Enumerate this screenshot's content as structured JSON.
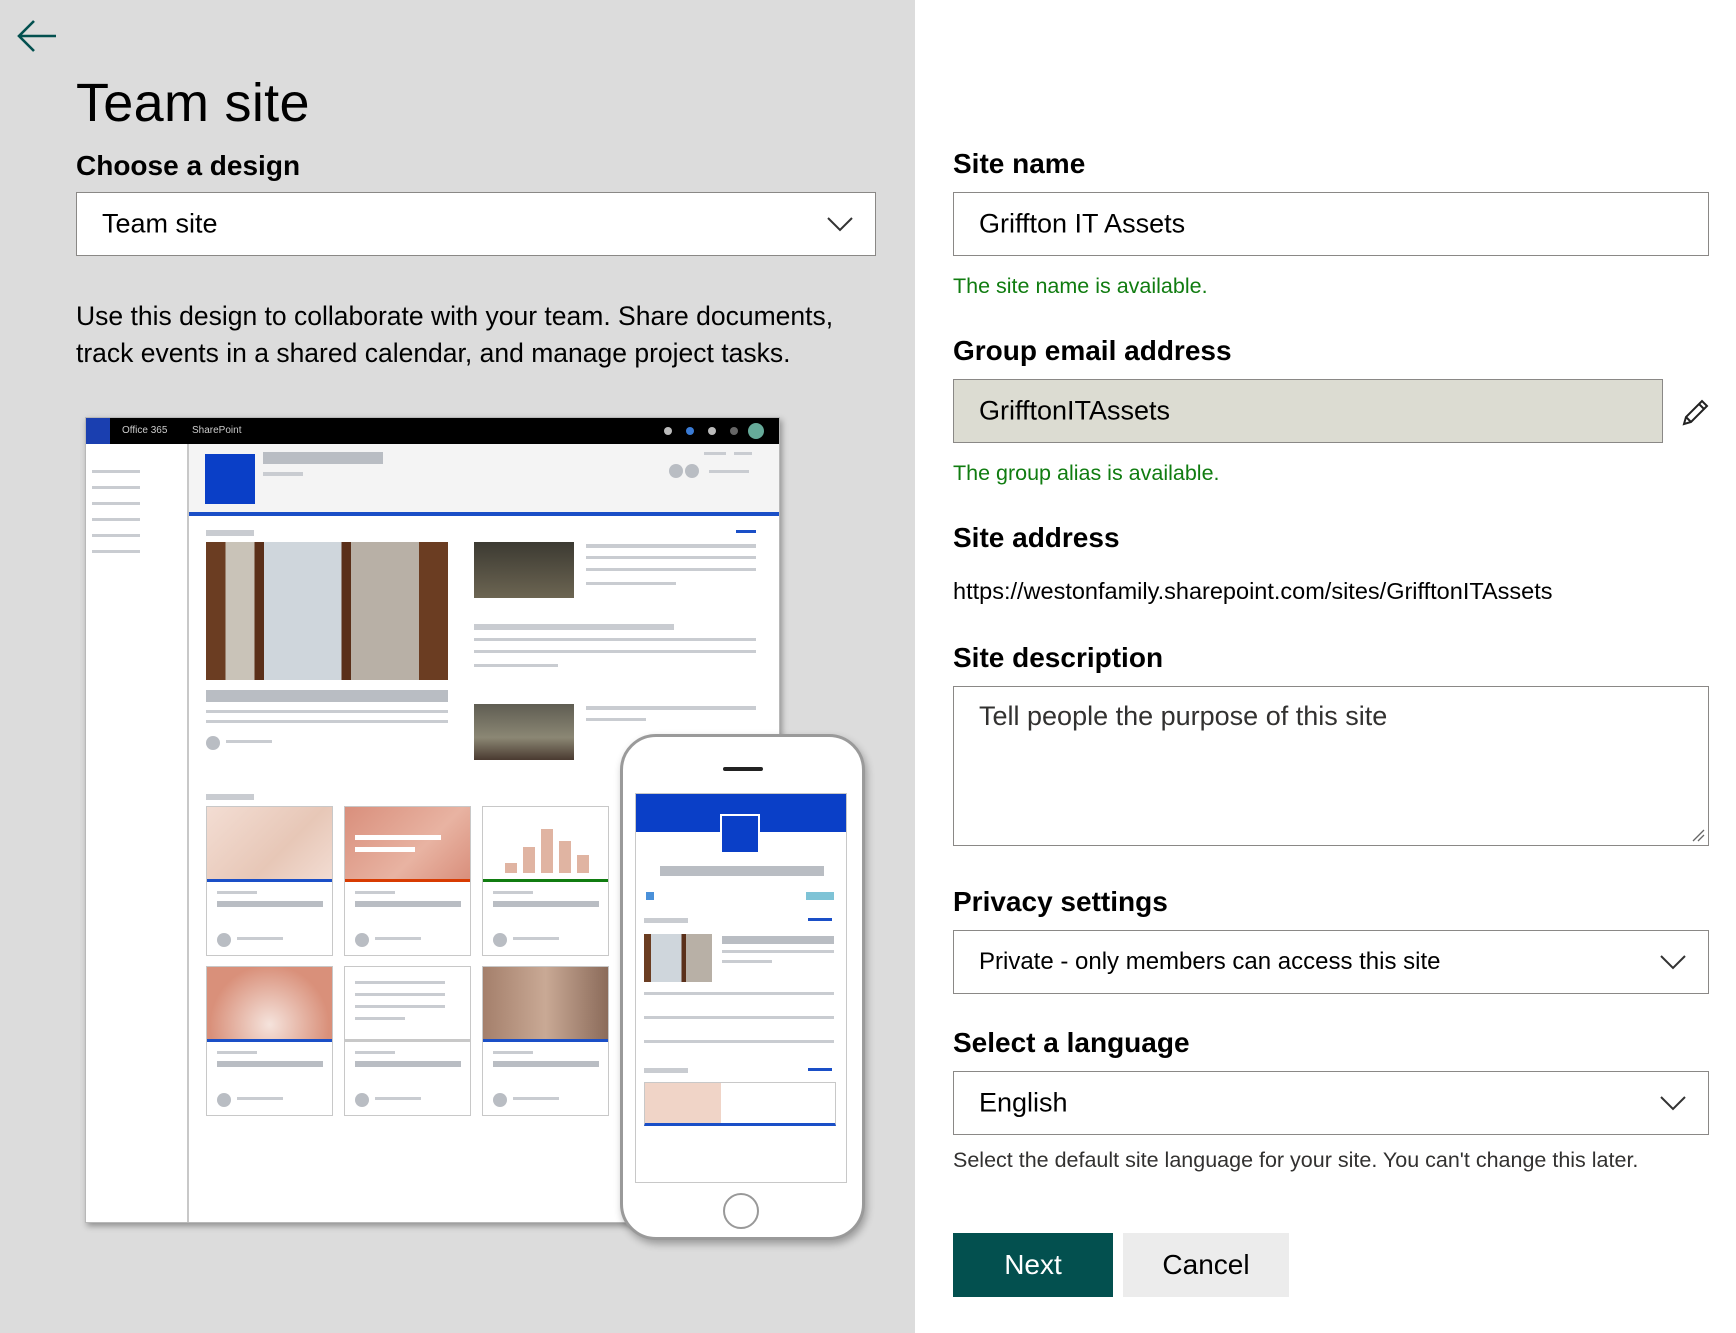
{
  "left": {
    "title": "Team site",
    "design_label": "Choose a design",
    "design_value": "Team site",
    "description": "Use this design to collaborate with your team. Share documents, track events in a shared calendar, and manage project tasks.",
    "preview": {
      "browser_brand": "Office 365",
      "browser_app": "SharePoint"
    }
  },
  "form": {
    "site_name_label": "Site name",
    "site_name_value": "Griffton IT Assets",
    "site_name_status": "The site name is available.",
    "group_email_label": "Group email address",
    "group_email_value": "GrifftonITAssets",
    "group_alias_status": "The group alias is available.",
    "site_address_label": "Site address",
    "site_address_value": "https://westonfamily.sharepoint.com/sites/GrifftonITAssets",
    "site_description_label": "Site description",
    "site_description_placeholder": "Tell people the purpose of this site",
    "privacy_label": "Privacy settings",
    "privacy_value": "Private - only members can access this site",
    "language_label": "Select a language",
    "language_value": "English",
    "language_hint": "Select the default site language for your site. You can't change this later.",
    "next_label": "Next",
    "cancel_label": "Cancel"
  },
  "colors": {
    "left_bg": "#dcdcdc",
    "success_text": "#107c10",
    "primary_button": "#03504f",
    "disabled_field": "#dcdcd2",
    "brand_blue": "#0a3fc7"
  },
  "icons": {
    "back": "arrow-left-icon",
    "dropdown": "chevron-down-icon",
    "edit": "pencil-icon"
  }
}
